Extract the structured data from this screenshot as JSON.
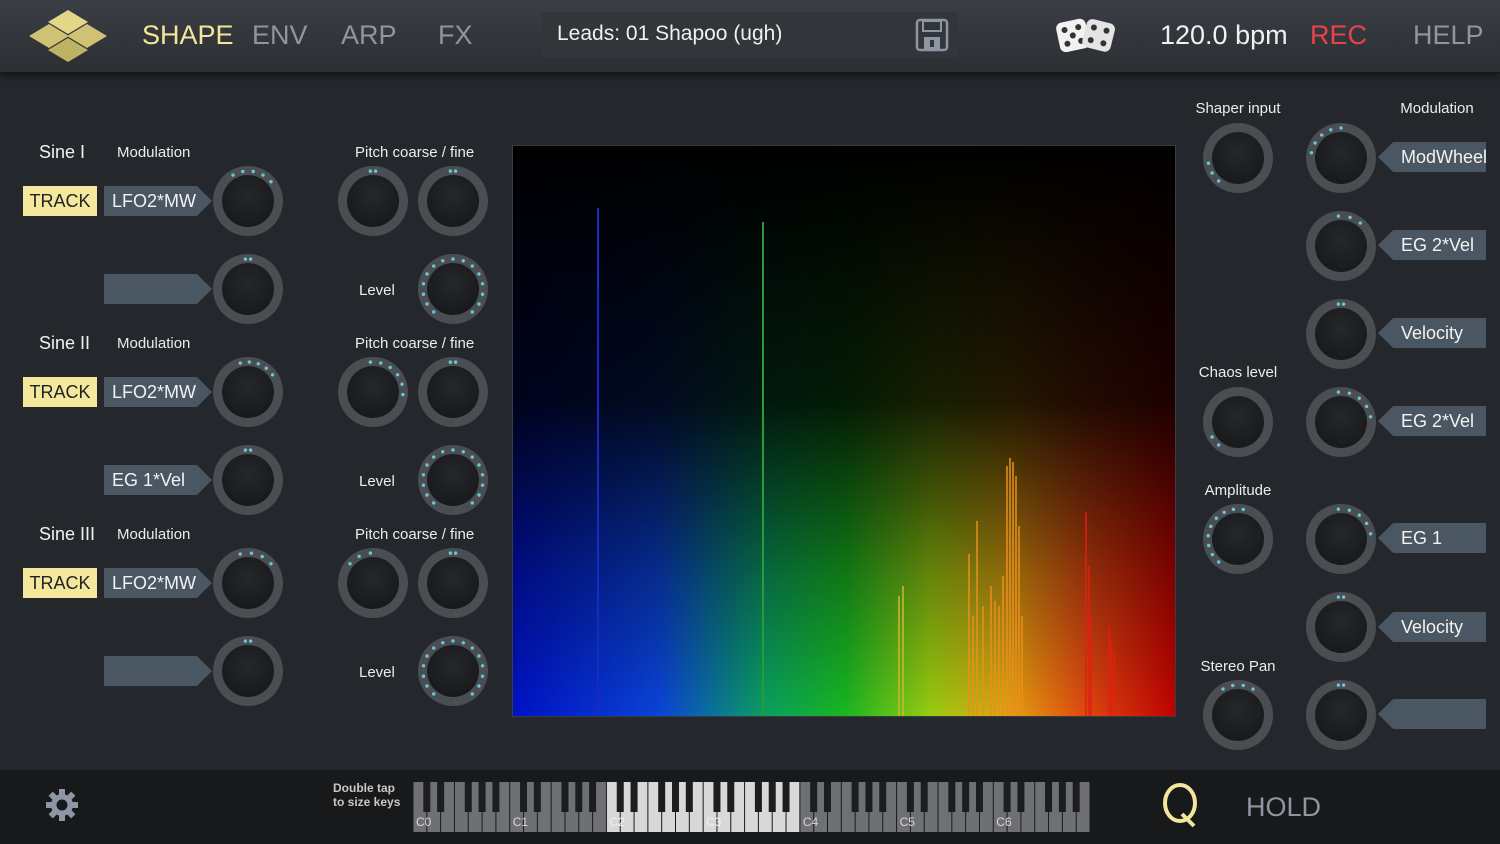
{
  "tabs": [
    {
      "label": "SHAPE",
      "active": true
    },
    {
      "label": "ENV",
      "active": false
    },
    {
      "label": "ARP",
      "active": false
    },
    {
      "label": "FX",
      "active": false
    }
  ],
  "preset": {
    "name": "Leads: 01 Shapoo (ugh)"
  },
  "header": {
    "bpm": "120.0 bpm",
    "rec": "REC",
    "help": "HELP"
  },
  "icons": {
    "logo": "diamond-logo-icon",
    "save": "floppy-disk-icon",
    "dice": "dice-icon",
    "settings": "gear-icon",
    "quantize": "q-icon"
  },
  "colors": {
    "accent": "#f3e69a",
    "rec": "#e8434a",
    "inactive": "#8e96a3",
    "tag": "#4a5762",
    "knob_dot": "#6bc7d6"
  },
  "oscillators": [
    {
      "title": "Sine I",
      "modulation_label": "Modulation",
      "track": "TRACK",
      "mod1": "LFO2*MW",
      "mod2": "",
      "pitch_label": "Pitch coarse / fine",
      "level_label": "Level"
    },
    {
      "title": "Sine II",
      "modulation_label": "Modulation",
      "track": "TRACK",
      "mod1": "LFO2*MW",
      "mod2": "EG 1*Vel",
      "pitch_label": "Pitch coarse / fine",
      "level_label": "Level"
    },
    {
      "title": "Sine III",
      "modulation_label": "Modulation",
      "track": "TRACK",
      "mod1": "LFO2*MW",
      "mod2": "",
      "pitch_label": "Pitch coarse / fine",
      "level_label": "Level"
    }
  ],
  "right": {
    "shaper_input": "Shaper input",
    "modulation": "Modulation",
    "chaos_level": "Chaos level",
    "amplitude": "Amplitude",
    "stereo_pan": "Stereo Pan",
    "mods": [
      "ModWheel",
      "EG 2*Vel",
      "Velocity",
      "EG 2*Vel",
      "EG 1",
      "Velocity",
      ""
    ]
  },
  "footer": {
    "hint_line1": "Double tap",
    "hint_line2": "to size keys",
    "octaves": [
      "C0",
      "C1",
      "C2",
      "C3",
      "C4",
      "C5",
      "C6"
    ],
    "hold": "HOLD"
  }
}
